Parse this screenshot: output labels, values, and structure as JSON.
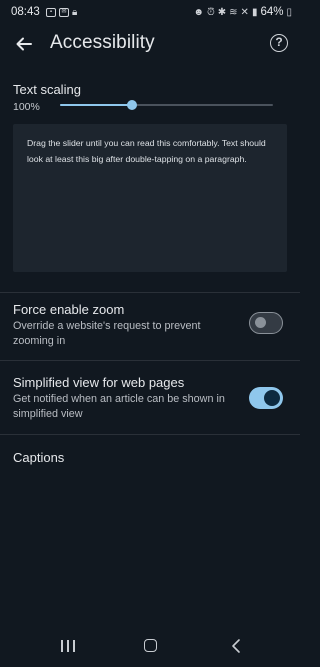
{
  "status_bar": {
    "time": "08:43",
    "battery": "64%",
    "icons": [
      "gallery-icon",
      "mail-icon",
      "lock-icon",
      "robot-icon",
      "alarm-icon",
      "bluetooth-icon",
      "wifi-icon",
      "mute-icon",
      "signal-icon",
      "battery-icon"
    ]
  },
  "app_bar": {
    "title": "Accessibility"
  },
  "text_scaling": {
    "label": "Text scaling",
    "percent": "100%",
    "slider_value": 0.34,
    "preview_text": "Drag the slider until you can read this comfortably. Text should look at least this big after double-tapping on a paragraph."
  },
  "force_zoom": {
    "title": "Force enable zoom",
    "subtitle": "Override a website's request to prevent zooming in",
    "enabled": false
  },
  "simplified_view": {
    "title": "Simplified view for web pages",
    "subtitle": "Get notified when an article can be shown in simplified view",
    "enabled": true
  },
  "captions": {
    "label": "Captions"
  },
  "colors": {
    "background": "#111820",
    "accent": "#8fc7ec",
    "preview_bg": "#1d252e"
  }
}
